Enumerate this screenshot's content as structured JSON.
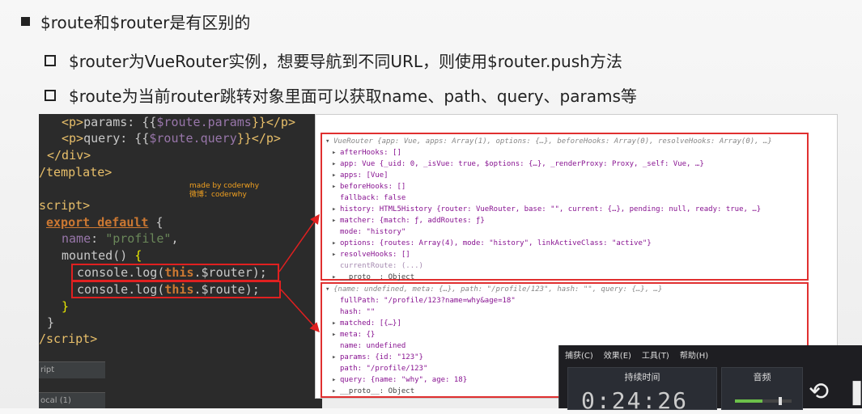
{
  "bullets": {
    "main": "$route和$router是有区别的",
    "sub1": "$router为VueRouter实例，想要导航到不同URL，则使用$router.push方法",
    "sub2": "$route为当前router跳转对象里面可以获取name、path、query、params等"
  },
  "code": {
    "line1": {
      "open": "<p>",
      "text": "params: {{",
      "prop": "$route.params",
      "close": "}}</p>"
    },
    "line2": {
      "open": "<p>",
      "text": "query: {{",
      "prop": "$route.query",
      "close": "}}</p>"
    },
    "line3": "</div>",
    "line4": "/template>",
    "line6": "script>",
    "line7_kw": "export default",
    "line7_rest": " {",
    "line8_key": "name",
    "line8_val": "\"profile\"",
    "line9_fn": "mounted() ",
    "line9_brace": "{",
    "line10_a": "console.log(",
    "line10_this": "this",
    "line10_b": ".$router);",
    "line11_a": "console.log(",
    "line11_this": "this",
    "line11_b": ".$route);",
    "line12": "}",
    "line13": "}",
    "line14": "/script>",
    "watermark1": "made by coderwhy",
    "watermark2": "微博：coderwhy",
    "footer1": "ript",
    "footer2": "ocal (1)"
  },
  "console": {
    "router": [
      "VueRouter {app: Vue, apps: Array(1), options: {…}, beforeHooks: Array(0), resolveHooks: Array(0), …}",
      "afterHooks: []",
      "app: Vue {_uid: 0, _isVue: true, $options: {…}, _renderProxy: Proxy, _self: Vue, …}",
      "apps: [Vue]",
      "beforeHooks: []",
      "fallback: false",
      "history: HTML5History {router: VueRouter, base: \"\", current: {…}, pending: null, ready: true, …}",
      "matcher: {match: ƒ, addRoutes: ƒ}",
      "mode: \"history\"",
      "options: {routes: Array(4), mode: \"history\", linkActiveClass: \"active\"}",
      "resolveHooks: []",
      "currentRoute: (...)",
      "__proto__: Object"
    ],
    "route": [
      "{name: undefined, meta: {…}, path: \"/profile/123\", hash: \"\", query: {…}, …}",
      "fullPath: \"/profile/123?name=why&age=18\"",
      "hash: \"\"",
      "matched: [{…}]",
      "meta: {}",
      "name: undefined",
      "params: {id: \"123\"}",
      "path: \"/profile/123\"",
      "query: {name: \"why\", age: 18}",
      "__proto__: Object"
    ]
  },
  "recorder": {
    "menu": [
      "捕获(C)",
      "效果(E)",
      "工具(T)",
      "帮助(H)"
    ],
    "duration_label": "持续时间",
    "duration": "0:24:26",
    "audio_label": "音频"
  },
  "colors": {
    "highlight": "#e02020",
    "editor_bg": "#2b2b2b"
  }
}
